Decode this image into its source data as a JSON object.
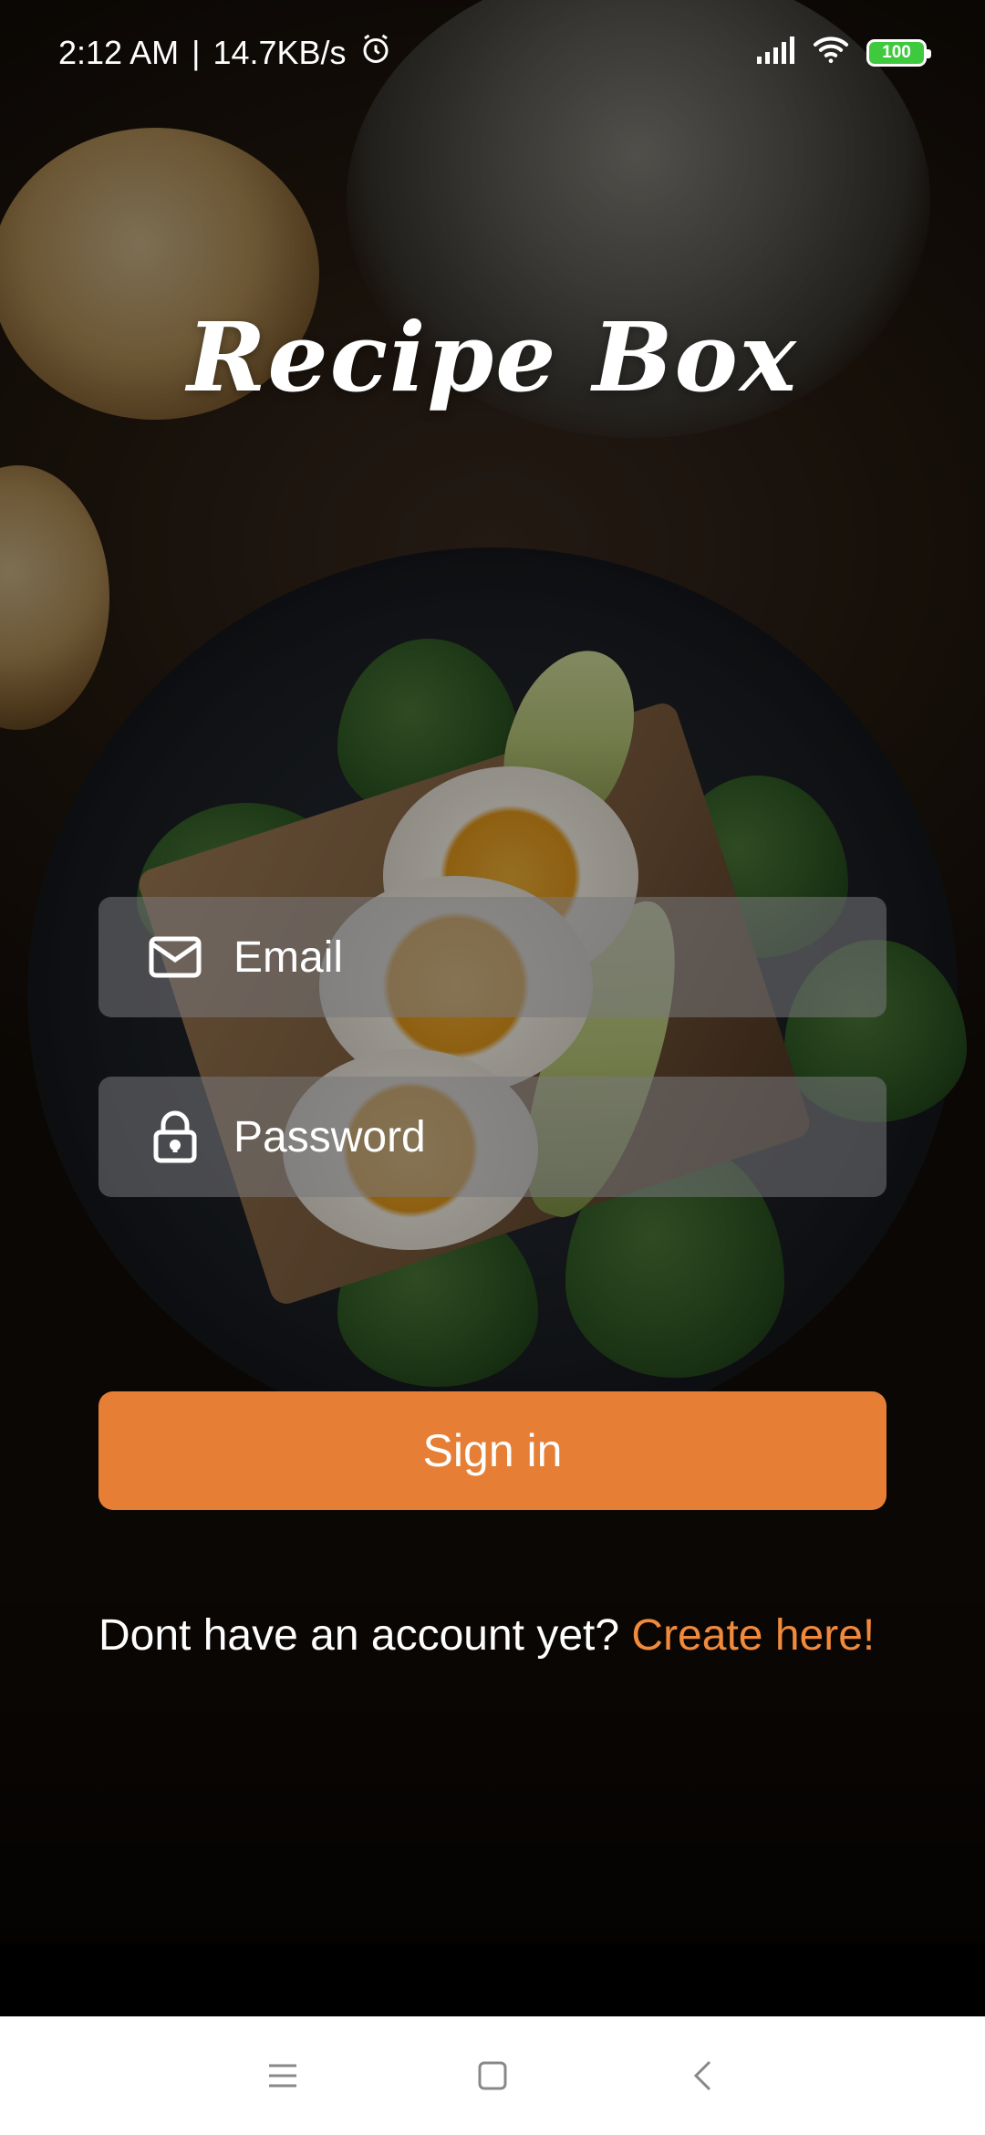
{
  "status_bar": {
    "time": "2:12  AM",
    "separator": "|",
    "network_speed": "14.7KB/s",
    "alarm_icon": "alarm-clock-icon",
    "signal_icon": "cellular-signal-icon",
    "wifi_icon": "wifi-icon",
    "battery_level": "100",
    "battery_color": "#3fc93f"
  },
  "app": {
    "title": "Recipe Box"
  },
  "form": {
    "email_placeholder": "Email",
    "email_value": "",
    "email_icon": "envelope-icon",
    "password_placeholder": "Password",
    "password_value": "",
    "password_icon": "lock-icon",
    "signin_label": "Sign in",
    "signin_color": "#e67f35"
  },
  "signup": {
    "prompt": "Dont have an account yet?",
    "link": "Create here!",
    "link_color": "#f08a3c"
  },
  "nav_bar": {
    "menu_icon": "menu-icon",
    "home_icon": "home-square-icon",
    "back_icon": "back-chevron-icon"
  }
}
